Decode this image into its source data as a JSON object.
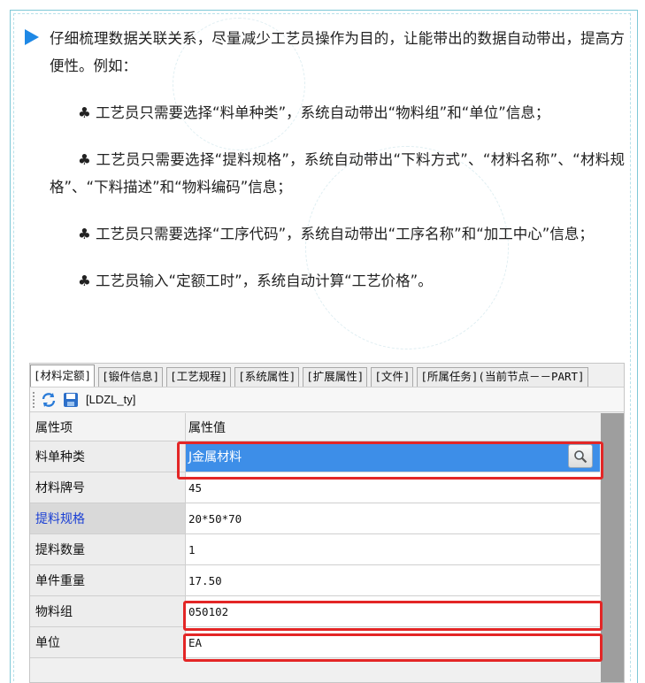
{
  "article": {
    "intro": "仔细梳理数据关联关系，尽量减少工艺员操作为目的，让能带出的数据自动带出，提高方便性。例如：",
    "bullets": [
      {
        "symbol": "♣",
        "text": " 工艺员只需要选择“料单种类”，系统自动带出“物料组”和“单位”信息；"
      },
      {
        "symbol": "♣",
        "text": " 工艺员只需要选择“提料规格”，系统自动带出“下料方式”、“材料名称”、“材料规格”、“下料描述”和“物料编码”信息；"
      },
      {
        "symbol": "♣",
        "text": " 工艺员只需要选择“工序代码”，系统自动带出“工序名称”和“加工中心”信息；"
      },
      {
        "symbol": "♣",
        "text": " 工艺员输入“定额工时”，系统自动计算“工艺价格”。"
      }
    ]
  },
  "tabs": [
    {
      "label": "[材料定额]",
      "active": true
    },
    {
      "label": "[锻件信息]"
    },
    {
      "label": "[工艺规程]"
    },
    {
      "label": "[系统属性]"
    },
    {
      "label": "[扩展属性]"
    },
    {
      "label": "[文件]"
    },
    {
      "label": "[所属任务](当前节点－－PART]"
    }
  ],
  "toolbar": {
    "label": "[LDZL_ty]"
  },
  "grid": {
    "headers": {
      "name": "属性项",
      "value": "属性值"
    },
    "rows": [
      {
        "name": "料单种类",
        "value": "J金属材料"
      },
      {
        "name": "材料牌号",
        "value": "45"
      },
      {
        "name": "提料规格",
        "value": "20*50*70"
      },
      {
        "name": "提料数量",
        "value": "1"
      },
      {
        "name": "单件重量",
        "value": "17.50"
      },
      {
        "name": "物料组",
        "value": "050102"
      },
      {
        "name": "单位",
        "value": "EA"
      }
    ]
  },
  "colors": {
    "accent": "#1e88e5",
    "highlight": "#e32626",
    "selected": "#3d8ee8",
    "link": "#1a3fd4"
  }
}
